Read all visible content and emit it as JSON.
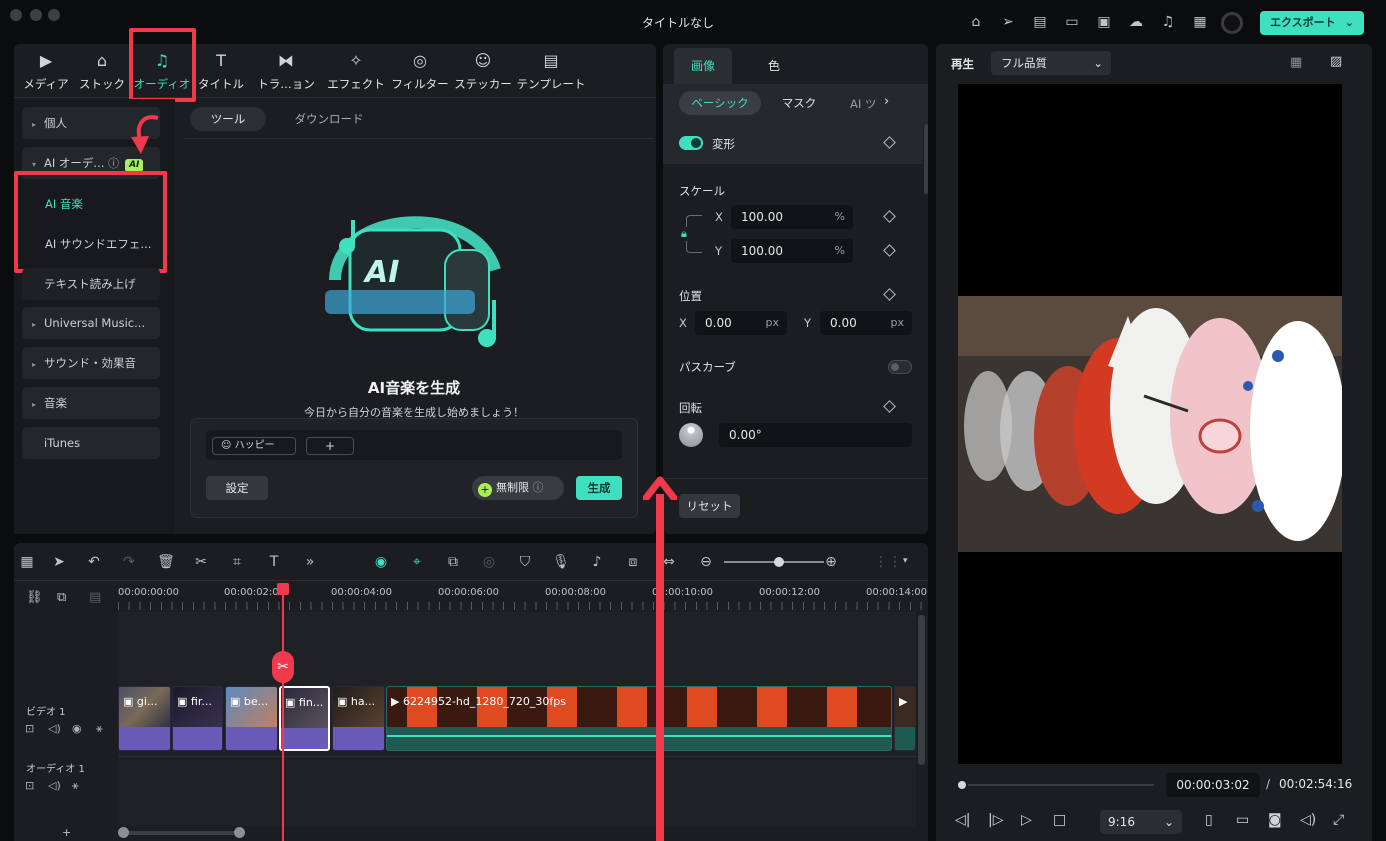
{
  "window": {
    "title": "タイトルなし"
  },
  "header": {
    "export_label": "エクスポート"
  },
  "media_tabs": [
    {
      "label": "メディア",
      "icon": "media-icon"
    },
    {
      "label": "ストック",
      "icon": "stock-icon"
    },
    {
      "label": "オーディオ",
      "icon": "music-note-icon"
    },
    {
      "label": "タイトル",
      "icon": "title-icon"
    },
    {
      "label": "トラ…ョン",
      "icon": "transition-icon"
    },
    {
      "label": "エフェクト",
      "icon": "effect-icon"
    },
    {
      "label": "フィルター",
      "icon": "filter-icon"
    },
    {
      "label": "ステッカー",
      "icon": "sticker-icon"
    },
    {
      "label": "テンプレート",
      "icon": "template-icon"
    }
  ],
  "sidebar": {
    "personal": "個人",
    "ai_audio": "AI オーデ...",
    "ai_badge": "AI",
    "ai_music": "AI 音楽",
    "ai_sfx": "AI サウンドエフェ...",
    "tts": "テキスト読み上げ",
    "universal": "Universal Music...",
    "sound_fx": "サウンド・効果音",
    "music": "音楽",
    "itunes": "iTunes"
  },
  "content_tabs": {
    "tools": "ツール",
    "download": "ダウンロード"
  },
  "ai_music": {
    "title": "AI音楽を生成",
    "subtitle": "今日から自分の音楽を生成し始めましょう！",
    "tag": "ハッピー",
    "add": "+",
    "settings": "設定",
    "unlimited": "無制限",
    "generate": "生成"
  },
  "properties": {
    "tab_image": "画像",
    "tab_color": "色",
    "sub_basic": "ベーシック",
    "sub_mask": "マスク",
    "sub_ai": "AI ツ",
    "transform": "変形",
    "scale": "スケール",
    "scale_x": "100.00",
    "scale_y": "100.00",
    "percent": "%",
    "x": "X",
    "y": "Y",
    "position": "位置",
    "pos_x": "0.00",
    "pos_y": "0.00",
    "px": "px",
    "pathcurve": "パスカーブ",
    "rotate": "回転",
    "rotate_val": "0.00°",
    "reset": "リセット"
  },
  "preview": {
    "play_label": "再生",
    "quality": "フル品質",
    "current_time": "00:00:03:02",
    "separator": "/",
    "total_time": "00:02:54:16",
    "ratio": "9:16"
  },
  "timeline": {
    "ruler": [
      "00:00:00:00",
      "00:00:02:00",
      "00:00:04:00",
      "00:00:06:00",
      "00:00:08:00",
      "00:00:10:00",
      "00:00:12:00",
      "00:00:14:00"
    ],
    "video_track": "ビデオ 1",
    "audio_track": "オーディオ 1",
    "clips": [
      "gi...",
      "fir...",
      "be...",
      "fin...",
      "ha..."
    ],
    "long_clip": "6224952-hd_1280_720_30fps"
  },
  "colors": {
    "accent": "#3ee0c0",
    "annotation": "#f03a4c",
    "clip": "#6b5bb8"
  }
}
